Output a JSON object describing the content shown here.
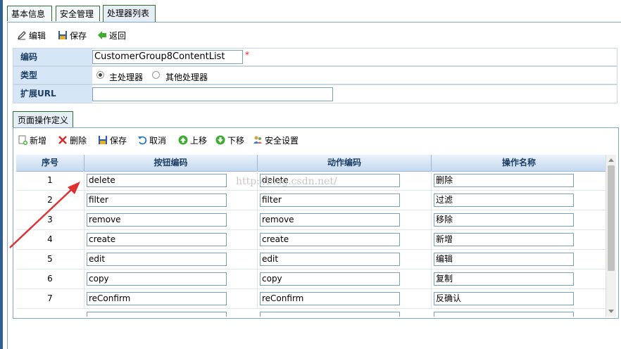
{
  "tabs": [
    "基本信息",
    "安全管理",
    "处理器列表"
  ],
  "toolbar": {
    "edit": "编辑",
    "save": "保存",
    "back": "返回"
  },
  "form": {
    "code_label": "编码",
    "code_value": "CustomerGroup8ContentList",
    "type_label": "类型",
    "type_options": [
      "主处理器",
      "其他处理器"
    ],
    "type_selected": "主处理器",
    "url_label": "扩展URL",
    "url_value": ""
  },
  "subtab": "页面操作定义",
  "subtoolbar": {
    "add": "新增",
    "delete": "删除",
    "save": "保存",
    "cancel": "取消",
    "up": "上移",
    "down": "下移",
    "security": "安全设置"
  },
  "grid": {
    "headers": [
      "序号",
      "按钮编码",
      "动作编码",
      "操作名称"
    ],
    "rows": [
      [
        "1",
        "delete",
        "delete",
        "删除"
      ],
      [
        "2",
        "filter",
        "filter",
        "过滤"
      ],
      [
        "3",
        "remove",
        "remove",
        "移除"
      ],
      [
        "4",
        "create",
        "create",
        "新增"
      ],
      [
        "5",
        "edit",
        "edit",
        "编辑"
      ],
      [
        "6",
        "copy",
        "copy",
        "复制"
      ],
      [
        "7",
        "reConfirm",
        "reConfirm",
        "反确认"
      ]
    ]
  },
  "watermark": "http://blog.csdn.net/",
  "colors": {
    "header_bg": "#c5d9ef",
    "label_bg": "#d7e6f6",
    "arrow": "#e03030",
    "required": "#e02020"
  }
}
